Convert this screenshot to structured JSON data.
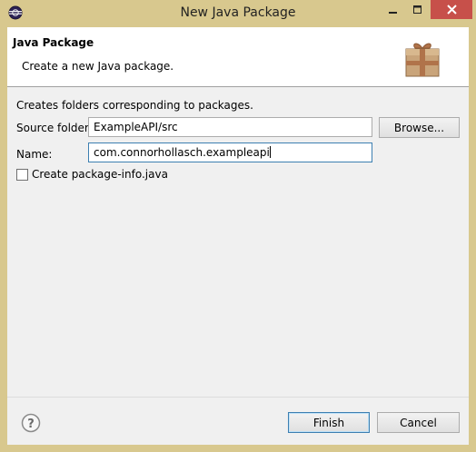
{
  "window": {
    "title": "New Java Package"
  },
  "header": {
    "title": "Java Package",
    "description": "Create a new Java package."
  },
  "body": {
    "intro": "Creates folders corresponding to packages.",
    "source_folder_label": "Source folder:",
    "source_folder_value": "ExampleAPI/src",
    "browse_label": "Browse...",
    "name_label": "Name:",
    "name_value": "com.connorhollasch.exampleapi",
    "package_info_label": "Create package-info.java",
    "package_info_checked": false
  },
  "footer": {
    "finish_label": "Finish",
    "cancel_label": "Cancel"
  },
  "colors": {
    "window_frame": "#d8c88e",
    "close_button": "#c7504a",
    "focus_border": "#3c7fb1"
  },
  "icons": [
    "eclipse-app-icon",
    "minimize-icon",
    "maximize-icon",
    "close-icon",
    "package-wizard-icon",
    "help-icon"
  ]
}
